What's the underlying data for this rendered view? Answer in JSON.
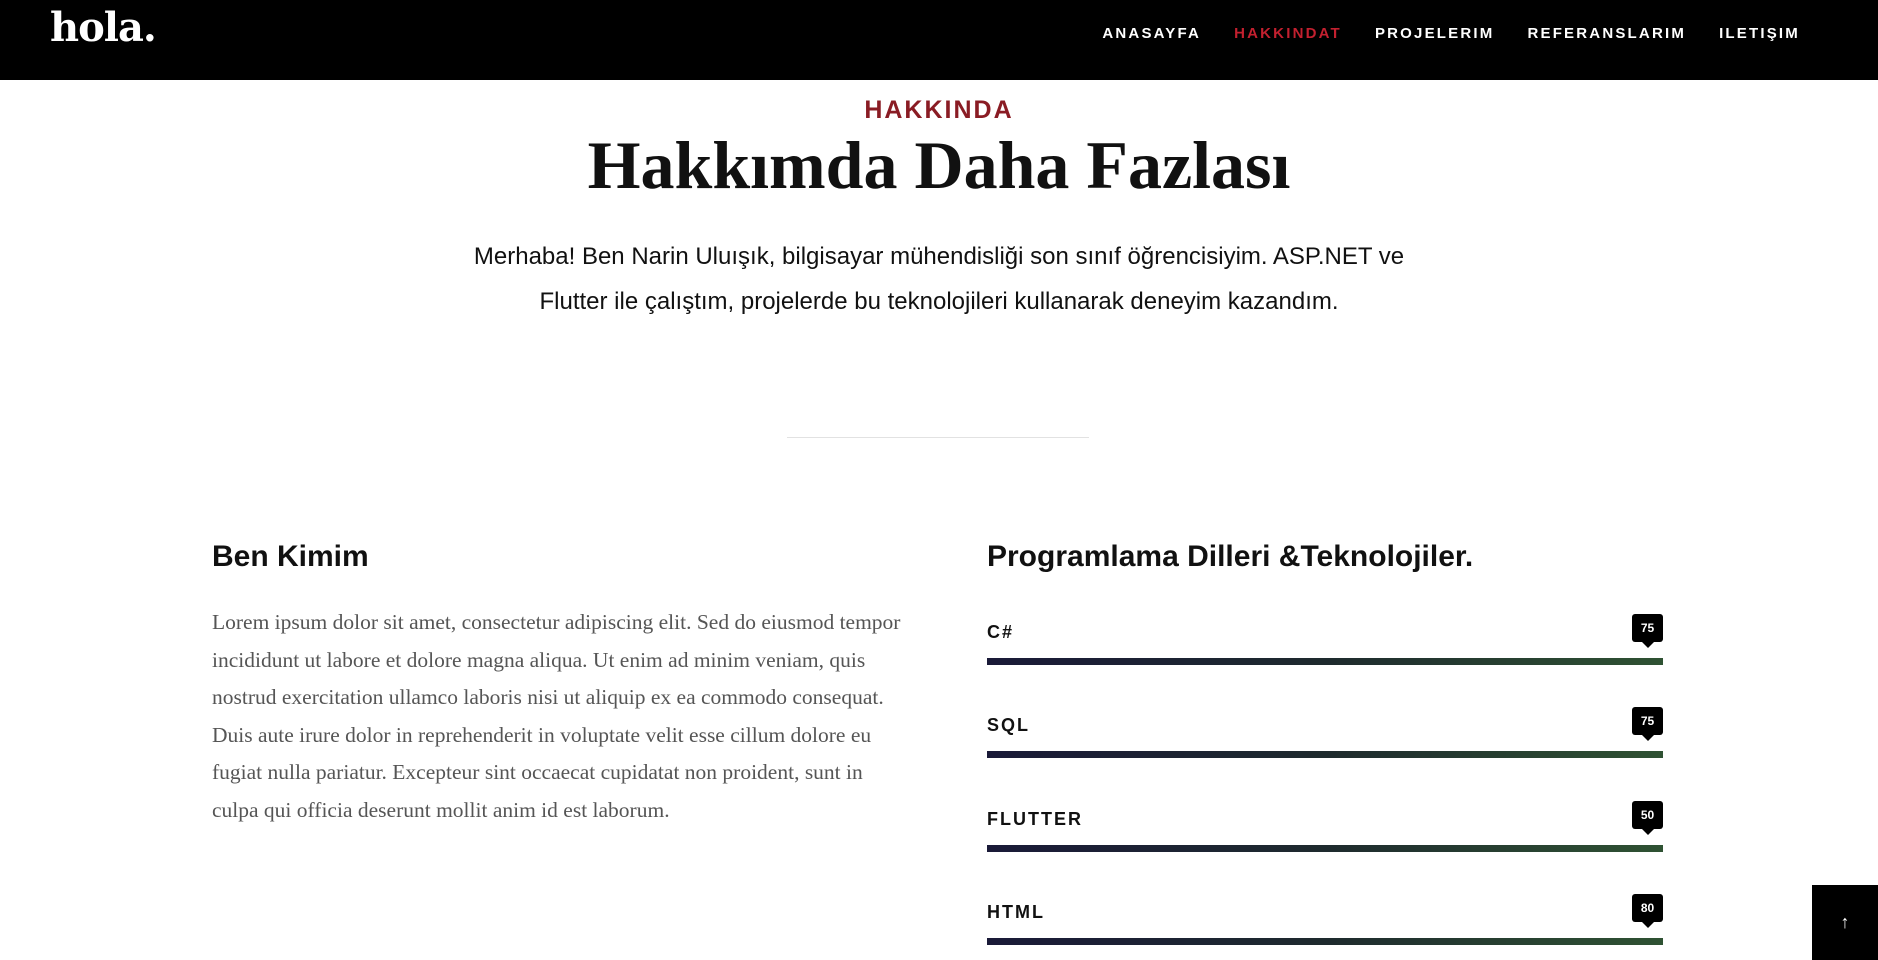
{
  "header": {
    "logo": "hola.",
    "nav": [
      {
        "label": "ANASAYFA",
        "active": false
      },
      {
        "label": "HAKKINDAT",
        "active": true
      },
      {
        "label": "PROJELERIM",
        "active": false
      },
      {
        "label": "REFERANSLARIM",
        "active": false
      },
      {
        "label": "ILETIŞIM",
        "active": false
      }
    ],
    "active_color": "#c3202f"
  },
  "intro": {
    "eyebrow": "HAKKINDA",
    "title": "Hakkımda Daha Fazlası",
    "text": "Merhaba! Ben Narin Uluışık, bilgisayar mühendisliği son sınıf öğrencisiyim. ASP.NET ve Flutter ile çalıştım, projelerde bu teknolojileri kullanarak deneyim kazandım."
  },
  "about": {
    "heading": "Ben Kimim",
    "body": "Lorem ipsum dolor sit amet, consectetur adipiscing elit. Sed do eiusmod tempor incididunt ut labore et dolore magna aliqua. Ut enim ad minim veniam, quis nostrud exercitation ullamco laboris nisi ut aliquip ex ea commodo consequat. Duis aute irure dolor in reprehenderit in voluptate velit esse cillum dolore eu fugiat nulla pariatur. Excepteur sint occaecat cupidatat non proident, sunt in culpa qui officia deserunt mollit anim id est laborum."
  },
  "skills": {
    "heading": "Programlama Dilleri &Teknolojiler.",
    "items": [
      {
        "label": "C#",
        "value": "75"
      },
      {
        "label": "SQL",
        "value": "75"
      },
      {
        "label": "FLUTTER",
        "value": "50"
      },
      {
        "label": "HTML",
        "value": "80"
      }
    ],
    "bar_colors": [
      "#1a1a38",
      "#2f5233"
    ]
  },
  "back_to_top": {
    "icon": "arrow-up-icon",
    "glyph": "↑"
  }
}
